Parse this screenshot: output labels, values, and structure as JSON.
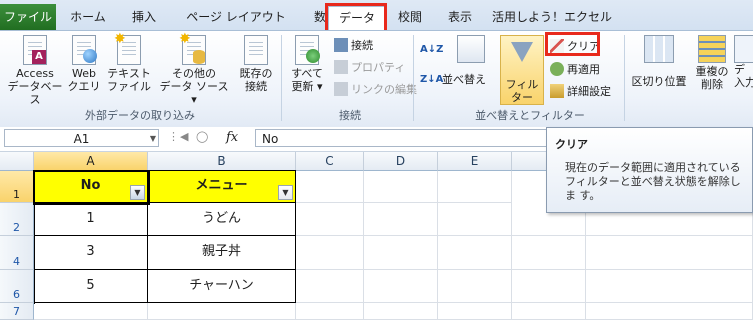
{
  "tabs": [
    {
      "label": "ファイル"
    },
    {
      "label": "ホーム"
    },
    {
      "label": "挿入"
    },
    {
      "label": "ページ レイアウト"
    },
    {
      "label": "数式"
    },
    {
      "label": "データ"
    },
    {
      "label": "校閲"
    },
    {
      "label": "表示"
    },
    {
      "label": "活用しよう！エクセル"
    }
  ],
  "ribbon": {
    "external": {
      "group_label": "外部データの取り込み",
      "access": "Access\nデータベース",
      "web": "Web\nクエリ",
      "text": "テキスト\nファイル",
      "other": "その他の\nデータ ソース ▾",
      "existing": "既存の\n接続"
    },
    "connections": {
      "group_label": "接続",
      "refresh_all": "すべて\n更新 ▾",
      "connections": "接続",
      "properties": "プロパティ",
      "edit_links": "リンクの編集"
    },
    "sortfilter": {
      "group_label": "並べ替えとフィルター",
      "sort_az": "A↓Z",
      "sort_za": "Z↓A",
      "sort": "並べ替え",
      "filter": "フィルター",
      "clear": "クリア",
      "reapply": "再適用",
      "advanced": "詳細設定"
    },
    "datatools": {
      "text_to_columns": "区切り位置",
      "remove_duplicates": "重複の\n削除",
      "data_validation": "デ\n入力"
    }
  },
  "formula_bar": {
    "name_box": "A1",
    "fx": "fx",
    "formula": "No"
  },
  "columns": [
    "A",
    "B",
    "C",
    "D",
    "E",
    "F"
  ],
  "row_numbers": [
    "1",
    "2",
    "4",
    "6",
    "7"
  ],
  "table": {
    "headers": [
      "No",
      "メニュー"
    ],
    "rows": [
      [
        "1",
        "うどん"
      ],
      [
        "3",
        "親子丼"
      ],
      [
        "5",
        "チャーハン"
      ]
    ]
  },
  "tooltip": {
    "title": "クリア",
    "body": "現在のデータ範囲に適用されている フィルターと並べ替え状態を解除しま す。"
  },
  "colors": {
    "highlight": "#e8291c",
    "header_fill": "#ffff00",
    "file_tab": "#2a7a2a",
    "filter_active": "#f9d36b"
  }
}
